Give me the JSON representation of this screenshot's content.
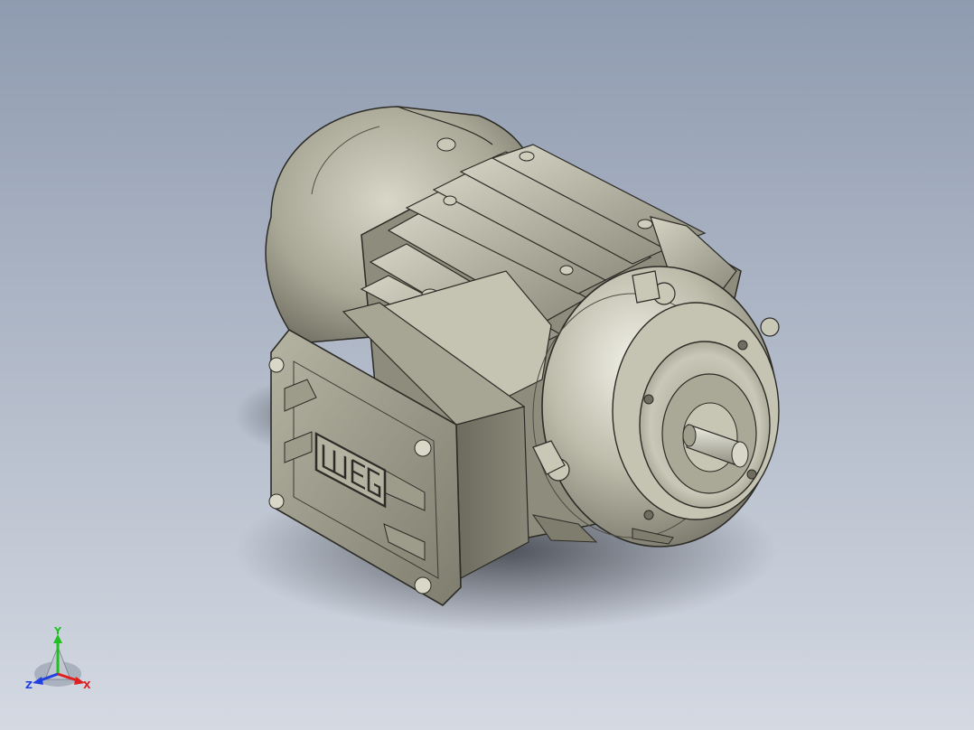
{
  "viewport": {
    "background_top": "#8f9bb0",
    "background_bottom": "#d4d9e2"
  },
  "model": {
    "brand_logo": "weg",
    "body_color": "#b8b6a4",
    "shadow_color": "#3b3f46"
  },
  "triad": {
    "x_label": "X",
    "y_label": "Y",
    "z_label": "Z",
    "x_color": "#e02020",
    "y_color": "#20c020",
    "z_color": "#2040e0"
  }
}
